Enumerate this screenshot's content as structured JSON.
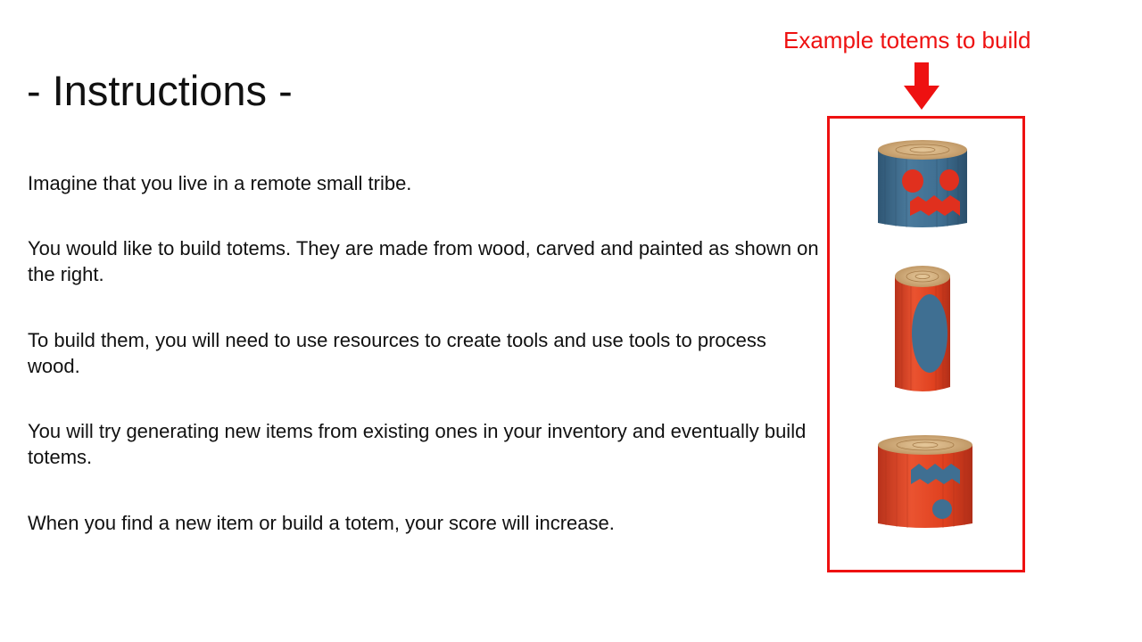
{
  "slide": {
    "title": "- Instructions -",
    "paragraphs": [
      "Imagine that you live in a remote small tribe.",
      "You would like to build totems. They are made from wood, carved and painted as shown on the right.",
      "To build them, you will need to use resources to create tools and use tools to process wood.",
      "You will try generating new items from existing ones in your inventory and eventually build totems.",
      "When you find a new item or build a totem, your score will increase."
    ]
  },
  "examples": {
    "label": "Example totems to build",
    "accent_color": "#ee1111",
    "totems": [
      {
        "icon": "blue-totem-with-round-eyes-and-zigzag-mouth-icon",
        "body_color": "#3f6f92",
        "carving_color": "#e0301e"
      },
      {
        "icon": "red-tall-totem-with-oval-carving-icon",
        "body_color": "#e0411f",
        "carving_color": "#3f6f92"
      },
      {
        "icon": "red-totem-with-zigzag-and-round-hole-icon",
        "body_color": "#e0411f",
        "carving_color": "#3f6f92"
      }
    ]
  }
}
